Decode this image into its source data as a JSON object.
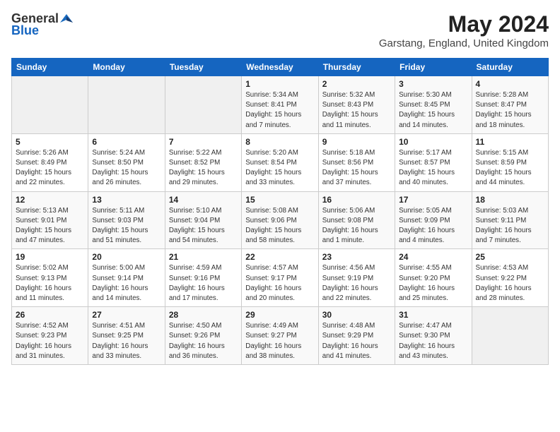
{
  "header": {
    "logo_general": "General",
    "logo_blue": "Blue",
    "title": "May 2024",
    "location": "Garstang, England, United Kingdom"
  },
  "days_of_week": [
    "Sunday",
    "Monday",
    "Tuesday",
    "Wednesday",
    "Thursday",
    "Friday",
    "Saturday"
  ],
  "weeks": [
    [
      {
        "day": "",
        "info": ""
      },
      {
        "day": "",
        "info": ""
      },
      {
        "day": "",
        "info": ""
      },
      {
        "day": "1",
        "info": "Sunrise: 5:34 AM\nSunset: 8:41 PM\nDaylight: 15 hours\nand 7 minutes."
      },
      {
        "day": "2",
        "info": "Sunrise: 5:32 AM\nSunset: 8:43 PM\nDaylight: 15 hours\nand 11 minutes."
      },
      {
        "day": "3",
        "info": "Sunrise: 5:30 AM\nSunset: 8:45 PM\nDaylight: 15 hours\nand 14 minutes."
      },
      {
        "day": "4",
        "info": "Sunrise: 5:28 AM\nSunset: 8:47 PM\nDaylight: 15 hours\nand 18 minutes."
      }
    ],
    [
      {
        "day": "5",
        "info": "Sunrise: 5:26 AM\nSunset: 8:49 PM\nDaylight: 15 hours\nand 22 minutes."
      },
      {
        "day": "6",
        "info": "Sunrise: 5:24 AM\nSunset: 8:50 PM\nDaylight: 15 hours\nand 26 minutes."
      },
      {
        "day": "7",
        "info": "Sunrise: 5:22 AM\nSunset: 8:52 PM\nDaylight: 15 hours\nand 29 minutes."
      },
      {
        "day": "8",
        "info": "Sunrise: 5:20 AM\nSunset: 8:54 PM\nDaylight: 15 hours\nand 33 minutes."
      },
      {
        "day": "9",
        "info": "Sunrise: 5:18 AM\nSunset: 8:56 PM\nDaylight: 15 hours\nand 37 minutes."
      },
      {
        "day": "10",
        "info": "Sunrise: 5:17 AM\nSunset: 8:57 PM\nDaylight: 15 hours\nand 40 minutes."
      },
      {
        "day": "11",
        "info": "Sunrise: 5:15 AM\nSunset: 8:59 PM\nDaylight: 15 hours\nand 44 minutes."
      }
    ],
    [
      {
        "day": "12",
        "info": "Sunrise: 5:13 AM\nSunset: 9:01 PM\nDaylight: 15 hours\nand 47 minutes."
      },
      {
        "day": "13",
        "info": "Sunrise: 5:11 AM\nSunset: 9:03 PM\nDaylight: 15 hours\nand 51 minutes."
      },
      {
        "day": "14",
        "info": "Sunrise: 5:10 AM\nSunset: 9:04 PM\nDaylight: 15 hours\nand 54 minutes."
      },
      {
        "day": "15",
        "info": "Sunrise: 5:08 AM\nSunset: 9:06 PM\nDaylight: 15 hours\nand 58 minutes."
      },
      {
        "day": "16",
        "info": "Sunrise: 5:06 AM\nSunset: 9:08 PM\nDaylight: 16 hours\nand 1 minute."
      },
      {
        "day": "17",
        "info": "Sunrise: 5:05 AM\nSunset: 9:09 PM\nDaylight: 16 hours\nand 4 minutes."
      },
      {
        "day": "18",
        "info": "Sunrise: 5:03 AM\nSunset: 9:11 PM\nDaylight: 16 hours\nand 7 minutes."
      }
    ],
    [
      {
        "day": "19",
        "info": "Sunrise: 5:02 AM\nSunset: 9:13 PM\nDaylight: 16 hours\nand 11 minutes."
      },
      {
        "day": "20",
        "info": "Sunrise: 5:00 AM\nSunset: 9:14 PM\nDaylight: 16 hours\nand 14 minutes."
      },
      {
        "day": "21",
        "info": "Sunrise: 4:59 AM\nSunset: 9:16 PM\nDaylight: 16 hours\nand 17 minutes."
      },
      {
        "day": "22",
        "info": "Sunrise: 4:57 AM\nSunset: 9:17 PM\nDaylight: 16 hours\nand 20 minutes."
      },
      {
        "day": "23",
        "info": "Sunrise: 4:56 AM\nSunset: 9:19 PM\nDaylight: 16 hours\nand 22 minutes."
      },
      {
        "day": "24",
        "info": "Sunrise: 4:55 AM\nSunset: 9:20 PM\nDaylight: 16 hours\nand 25 minutes."
      },
      {
        "day": "25",
        "info": "Sunrise: 4:53 AM\nSunset: 9:22 PM\nDaylight: 16 hours\nand 28 minutes."
      }
    ],
    [
      {
        "day": "26",
        "info": "Sunrise: 4:52 AM\nSunset: 9:23 PM\nDaylight: 16 hours\nand 31 minutes."
      },
      {
        "day": "27",
        "info": "Sunrise: 4:51 AM\nSunset: 9:25 PM\nDaylight: 16 hours\nand 33 minutes."
      },
      {
        "day": "28",
        "info": "Sunrise: 4:50 AM\nSunset: 9:26 PM\nDaylight: 16 hours\nand 36 minutes."
      },
      {
        "day": "29",
        "info": "Sunrise: 4:49 AM\nSunset: 9:27 PM\nDaylight: 16 hours\nand 38 minutes."
      },
      {
        "day": "30",
        "info": "Sunrise: 4:48 AM\nSunset: 9:29 PM\nDaylight: 16 hours\nand 41 minutes."
      },
      {
        "day": "31",
        "info": "Sunrise: 4:47 AM\nSunset: 9:30 PM\nDaylight: 16 hours\nand 43 minutes."
      },
      {
        "day": "",
        "info": ""
      }
    ]
  ]
}
